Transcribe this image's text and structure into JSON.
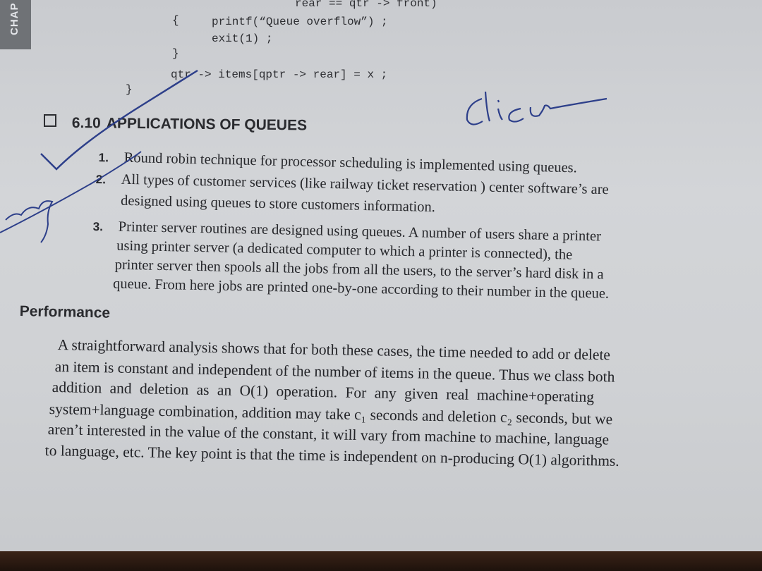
{
  "side_tab": {
    "label": "CHAP"
  },
  "code": {
    "line0": "rear == qtr -> front)",
    "line1_brace": "{",
    "line1": "printf(“Queue overflow”) ;",
    "line2": "exit(1) ;",
    "line3": "}",
    "line4": "qtr -> items[qptr -> rear] = x ;",
    "line5": "}"
  },
  "section": {
    "number": "6.10",
    "title": "APPLICATIONS OF QUEUES"
  },
  "list": [
    {
      "num": "1.",
      "lines": [
        "Round robin technique for processor scheduling is implemented using queues."
      ]
    },
    {
      "num": "2.",
      "lines": [
        "All types of customer services (like railway ticket reservation ) center software’s are",
        "designed using queues to store customers information."
      ]
    },
    {
      "num": "3.",
      "lines": [
        "Printer server routines are designed using queues. A number of users share a printer",
        "using printer server (a dedicated computer to which a printer is connected), the",
        "printer server then spools all the jobs from all the users, to the server’s hard disk in a",
        "queue. From here jobs are printed one-by-one according to their number in the queue."
      ]
    }
  ],
  "performance": {
    "heading": "Performance",
    "paragraph": [
      "A straightforward analysis shows that for both these cases, the time needed to add or delete",
      "an item is constant and independent of the number of items in the queue. Thus we class both",
      "addition and deletion as an O(1) operation. For any given real machine+operating",
      "system+language combination, addition may take c₁ seconds and deletion c₂ seconds, but we",
      "aren’t interested in the value of the constant, it will vary from machine to machine, language",
      "to language, etc. The key point is that the time is independent on n-producing O(1) algorithms."
    ]
  },
  "handwriting": {
    "note": "clice"
  },
  "colors": {
    "page": "#d0d2d5",
    "ink": "#2d3f8a",
    "text": "#26272b"
  }
}
